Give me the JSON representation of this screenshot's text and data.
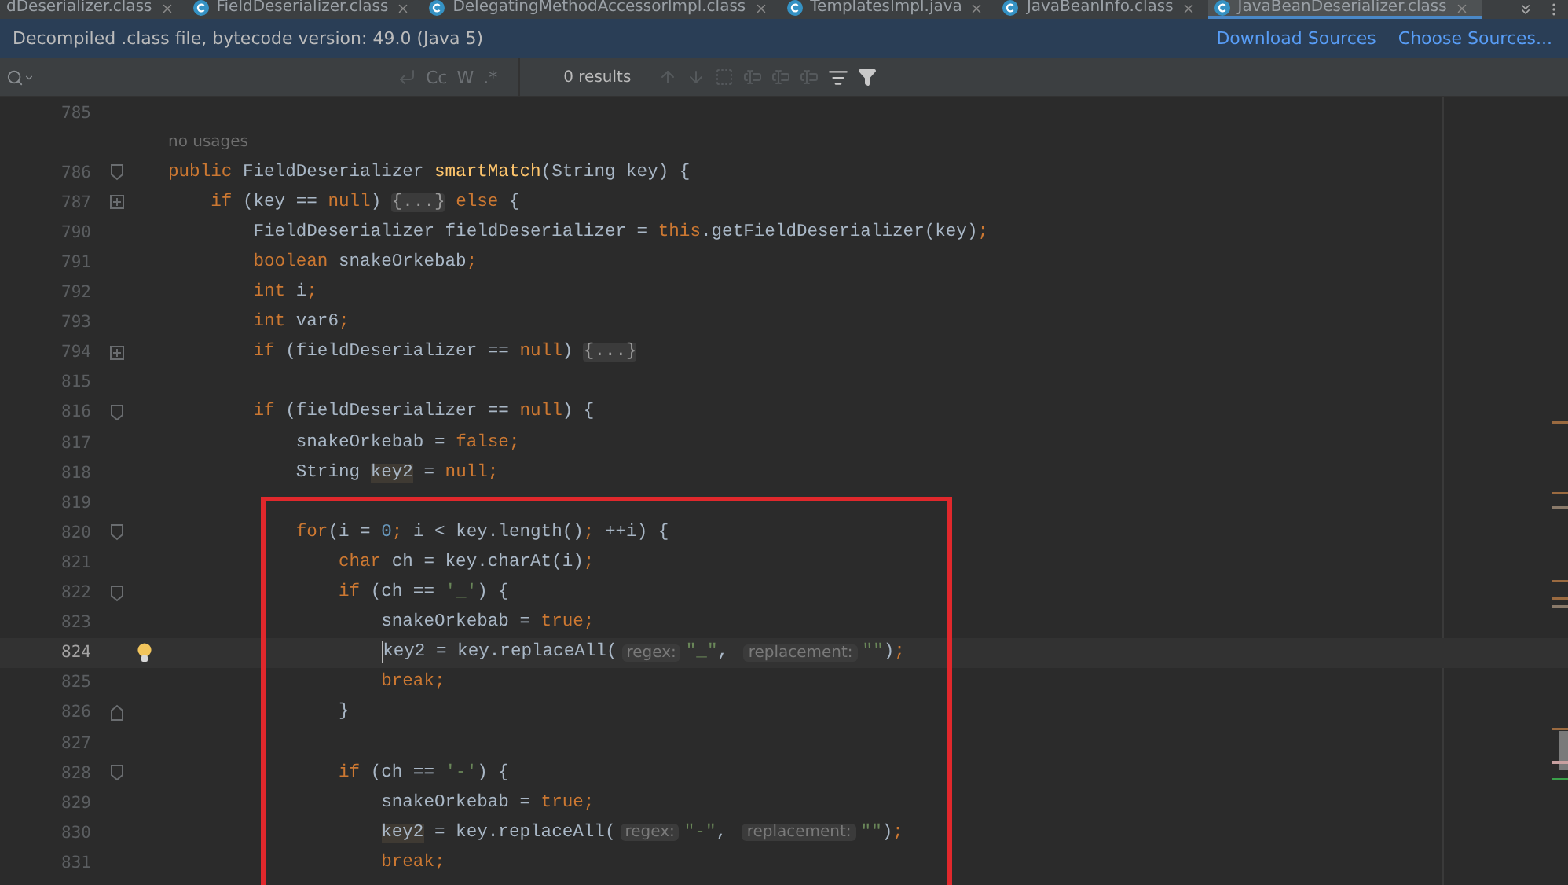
{
  "tabs": [
    {
      "label": "dDeserializer.class",
      "selected": false,
      "icon": false
    },
    {
      "label": "FieldDeserializer.class",
      "selected": false,
      "icon": true
    },
    {
      "label": "DelegatingMethodAccessorImpl.class",
      "selected": false,
      "icon": true
    },
    {
      "label": "TemplatesImpl.java",
      "selected": false,
      "icon": true
    },
    {
      "label": "JavaBeanInfo.class",
      "selected": false,
      "icon": true
    },
    {
      "label": "JavaBeanDeserializer.class",
      "selected": true,
      "icon": true
    }
  ],
  "banner": {
    "message": "Decompiled .class file, bytecode version: 49.0 (Java 5)",
    "links": [
      "Download Sources",
      "Choose Sources..."
    ]
  },
  "find_bar": {
    "options": [
      "Cc",
      "W",
      ".*"
    ],
    "results": "0 results"
  },
  "lines": [
    {
      "number": "785",
      "kind": "plain"
    },
    {
      "kind": "usages",
      "text": "no usages"
    },
    {
      "number": "786",
      "kind": "fold_open",
      "tokens": [
        {
          "kind": "kw",
          "text": "public "
        },
        {
          "kind": "plain",
          "text": "FieldDeserializer "
        },
        {
          "kind": "method",
          "text": "smartMatch"
        },
        {
          "kind": "plain",
          "text": "(String key) {"
        }
      ]
    },
    {
      "number": "787",
      "kind": "collapsed",
      "tokens": [
        {
          "kind": "kw",
          "text": "    if "
        },
        {
          "kind": "plain",
          "text": "(key == "
        },
        {
          "kind": "kw",
          "text": "null"
        },
        {
          "kind": "plain",
          "text": ") "
        },
        {
          "kind": "folded",
          "text": "{...}"
        },
        {
          "kind": "kw",
          "text": " else"
        },
        {
          "kind": "plain",
          "text": " {"
        }
      ]
    },
    {
      "number": "790",
      "kind": "plain",
      "tokens": [
        {
          "kind": "plain",
          "text": "        FieldDeserializer fieldDeserializer = "
        },
        {
          "kind": "kw",
          "text": "this"
        },
        {
          "kind": "plain",
          "text": ".getFieldDeserializer(key)"
        },
        {
          "kind": "kw",
          "text": ";"
        }
      ]
    },
    {
      "number": "791",
      "kind": "plain",
      "tokens": [
        {
          "kind": "kw",
          "text": "        boolean"
        },
        {
          "kind": "plain",
          "text": " snakeOrkebab"
        },
        {
          "kind": "kw",
          "text": ";"
        }
      ]
    },
    {
      "number": "792",
      "kind": "plain",
      "tokens": [
        {
          "kind": "kw",
          "text": "        int"
        },
        {
          "kind": "plain",
          "text": " i"
        },
        {
          "kind": "kw",
          "text": ";"
        }
      ]
    },
    {
      "number": "793",
      "kind": "plain",
      "tokens": [
        {
          "kind": "kw",
          "text": "        int"
        },
        {
          "kind": "plain",
          "text": " var6"
        },
        {
          "kind": "kw",
          "text": ";"
        }
      ]
    },
    {
      "number": "794",
      "kind": "collapsed",
      "tokens": [
        {
          "kind": "kw",
          "text": "        if "
        },
        {
          "kind": "plain",
          "text": "(fieldDeserializer == "
        },
        {
          "kind": "kw",
          "text": "null"
        },
        {
          "kind": "plain",
          "text": ") "
        },
        {
          "kind": "folded",
          "text": "{...}"
        }
      ]
    },
    {
      "number": "815",
      "kind": "plain"
    },
    {
      "number": "816",
      "kind": "fold_open",
      "tokens": [
        {
          "kind": "kw",
          "text": "        if "
        },
        {
          "kind": "plain",
          "text": "(fieldDeserializer == "
        },
        {
          "kind": "kw",
          "text": "null"
        },
        {
          "kind": "plain",
          "text": ") {"
        }
      ]
    },
    {
      "number": "817",
      "kind": "plain",
      "tokens": [
        {
          "kind": "plain",
          "text": "            snakeOrkebab = "
        },
        {
          "kind": "kw",
          "text": "false"
        },
        {
          "kind": "kw",
          "text": ";"
        }
      ]
    },
    {
      "number": "818",
      "kind": "plain",
      "tokens": [
        {
          "kind": "plain",
          "text": "            String "
        },
        {
          "kind": "usage",
          "text": "key2"
        },
        {
          "kind": "plain",
          "text": " = "
        },
        {
          "kind": "kw",
          "text": "null"
        },
        {
          "kind": "kw",
          "text": ";"
        }
      ]
    },
    {
      "number": "819",
      "kind": "plain"
    },
    {
      "number": "820",
      "kind": "fold_open",
      "tokens": [
        {
          "kind": "kw",
          "text": "            for"
        },
        {
          "kind": "plain",
          "text": "(i = "
        },
        {
          "kind": "num",
          "text": "0"
        },
        {
          "kind": "kw",
          "text": ";"
        },
        {
          "kind": "plain",
          "text": " i < key.length()"
        },
        {
          "kind": "kw",
          "text": ";"
        },
        {
          "kind": "plain",
          "text": " ++i) {"
        }
      ]
    },
    {
      "number": "821",
      "kind": "plain",
      "tokens": [
        {
          "kind": "kw",
          "text": "                char"
        },
        {
          "kind": "plain",
          "text": " ch = key.charAt(i)"
        },
        {
          "kind": "kw",
          "text": ";"
        }
      ]
    },
    {
      "number": "822",
      "kind": "fold_open",
      "tokens": [
        {
          "kind": "kw",
          "text": "                if "
        },
        {
          "kind": "plain",
          "text": "(ch == "
        },
        {
          "kind": "str",
          "text": "'_'"
        },
        {
          "kind": "plain",
          "text": ") {"
        }
      ]
    },
    {
      "number": "823",
      "kind": "plain",
      "tokens": [
        {
          "kind": "plain",
          "text": "                    snakeOrkebab = "
        },
        {
          "kind": "kw",
          "text": "true"
        },
        {
          "kind": "kw",
          "text": ";"
        }
      ]
    },
    {
      "number": "824",
      "kind": "plain",
      "current": true,
      "bulb": true,
      "tokens": [
        {
          "kind": "plain",
          "text": "                    key2 = key.replaceAll("
        },
        {
          "kind": "hint",
          "text": "regex:"
        },
        {
          "kind": "str",
          "text": "\"_\""
        },
        {
          "kind": "plain",
          "text": ", "
        },
        {
          "kind": "hint",
          "text": "replacement:"
        },
        {
          "kind": "str",
          "text": "\"\""
        },
        {
          "kind": "plain",
          "text": ")"
        },
        {
          "kind": "kw",
          "text": ";"
        }
      ]
    },
    {
      "number": "825",
      "kind": "plain",
      "tokens": [
        {
          "kind": "kw",
          "text": "                    break;"
        }
      ]
    },
    {
      "number": "826",
      "kind": "fold_close",
      "tokens": [
        {
          "kind": "plain",
          "text": "                }"
        }
      ]
    },
    {
      "number": "827",
      "kind": "plain"
    },
    {
      "number": "828",
      "kind": "fold_open",
      "tokens": [
        {
          "kind": "kw",
          "text": "                if "
        },
        {
          "kind": "plain",
          "text": "(ch == "
        },
        {
          "kind": "str",
          "text": "'-'"
        },
        {
          "kind": "plain",
          "text": ") {"
        }
      ]
    },
    {
      "number": "829",
      "kind": "plain",
      "tokens": [
        {
          "kind": "plain",
          "text": "                    snakeOrkebab = "
        },
        {
          "kind": "kw",
          "text": "true"
        },
        {
          "kind": "kw",
          "text": ";"
        }
      ]
    },
    {
      "number": "830",
      "kind": "plain",
      "tokens": [
        {
          "kind": "usage",
          "text": "                    key2"
        },
        {
          "kind": "plain",
          "text": " = key.replaceAll("
        },
        {
          "kind": "hint",
          "text": "regex:"
        },
        {
          "kind": "str",
          "text": "\"-\""
        },
        {
          "kind": "plain",
          "text": ", "
        },
        {
          "kind": "hint",
          "text": "replacement:"
        },
        {
          "kind": "str",
          "text": "\"\""
        },
        {
          "kind": "plain",
          "text": ")"
        },
        {
          "kind": "kw",
          "text": ";"
        }
      ]
    },
    {
      "number": "831",
      "kind": "plain",
      "tokens": [
        {
          "kind": "kw",
          "text": "                    break;"
        }
      ]
    }
  ]
}
